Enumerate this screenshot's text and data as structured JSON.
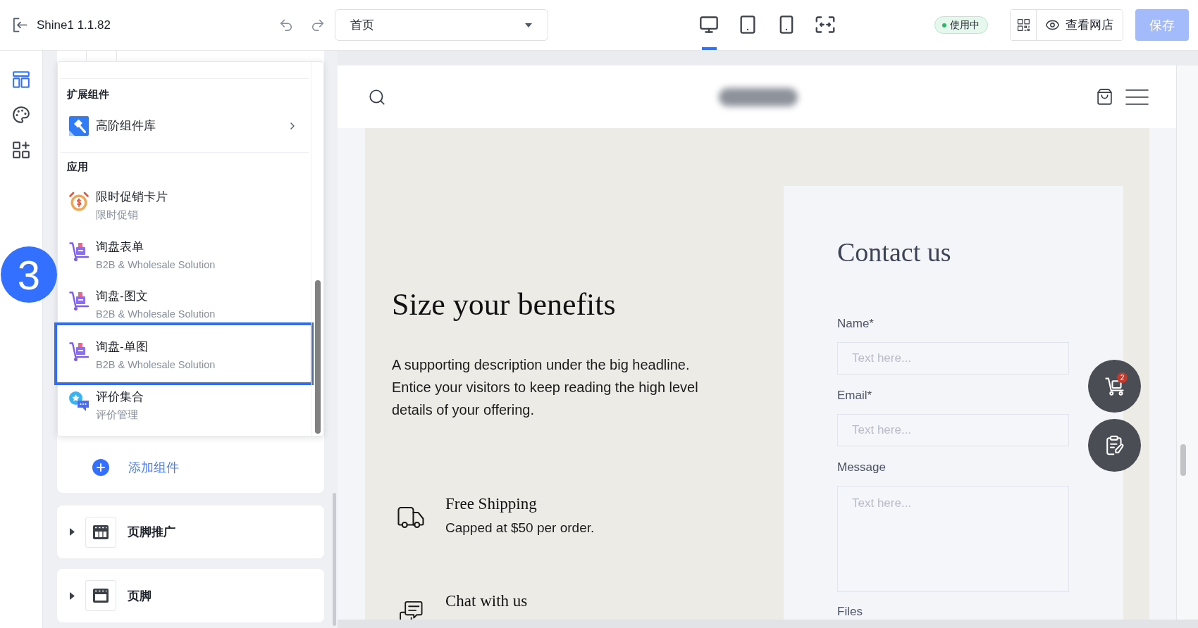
{
  "top_bar": {
    "title": "Shine1 1.1.82",
    "page_select": {
      "value": "首页"
    },
    "devices": [
      {
        "kind": "desktop",
        "selected": true
      },
      {
        "kind": "tablet",
        "selected": false
      },
      {
        "kind": "phone",
        "selected": false
      },
      {
        "kind": "fit",
        "selected": false
      }
    ],
    "status_badge": "使用中",
    "view_store_button": "查看网店",
    "save_button": {
      "label": "保存",
      "disabled": true
    }
  },
  "side_rail": [
    {
      "kind": "layout",
      "selected": true
    },
    {
      "kind": "theme",
      "selected": false
    },
    {
      "kind": "apps",
      "selected": false
    }
  ],
  "component_menu": {
    "sections": [
      {
        "heading": "扩展组件",
        "items": [
          {
            "kind": "library",
            "title": "高阶组件库",
            "has_submenu": true,
            "highlighted": false
          }
        ]
      },
      {
        "heading": "应用",
        "items": [
          {
            "kind": "promo",
            "title": "限时促销卡片",
            "subtitle": "限时促销",
            "highlighted": false
          },
          {
            "kind": "inquiry",
            "title": "询盘表单",
            "subtitle": "B2B & Wholesale Solution",
            "highlighted": false
          },
          {
            "kind": "inquiry",
            "title": "询盘-图文",
            "subtitle": "B2B & Wholesale Solution",
            "highlighted": false
          },
          {
            "kind": "inquiry",
            "title": "询盘-单图",
            "subtitle": "B2B & Wholesale Solution",
            "highlighted": true
          },
          {
            "kind": "review",
            "title": "评价集合",
            "subtitle": "评价管理",
            "highlighted": false
          }
        ]
      }
    ]
  },
  "add_component_button": "添加组件",
  "page_sections": [
    {
      "kind": "footer_promo",
      "label": "页脚推广",
      "expanded": false
    },
    {
      "kind": "footer",
      "label": "页脚",
      "expanded": false
    }
  ],
  "step_marker": "3",
  "preview": {
    "hero": {
      "title": "Size your benefits",
      "description": "A supporting description under the big headline. Entice your visitors to keep reading the high level details of your offering.",
      "features": [
        {
          "kind": "shipping",
          "title": "Free Shipping",
          "text": "Capped at $50 per order."
        },
        {
          "kind": "chat",
          "title": "Chat with us"
        }
      ]
    },
    "contact_form": {
      "title": "Contact us",
      "fields": [
        {
          "kind": "input",
          "label": "Name*",
          "placeholder": "Text here..."
        },
        {
          "kind": "input",
          "label": "Email*",
          "placeholder": "Text here..."
        },
        {
          "kind": "textarea",
          "label": "Message",
          "placeholder": "Text here..."
        },
        {
          "kind": "file",
          "label": "Files"
        }
      ]
    },
    "floating_buttons": [
      {
        "kind": "inquiry_cart",
        "badge": "2"
      },
      {
        "kind": "inquiry_form"
      }
    ]
  }
}
